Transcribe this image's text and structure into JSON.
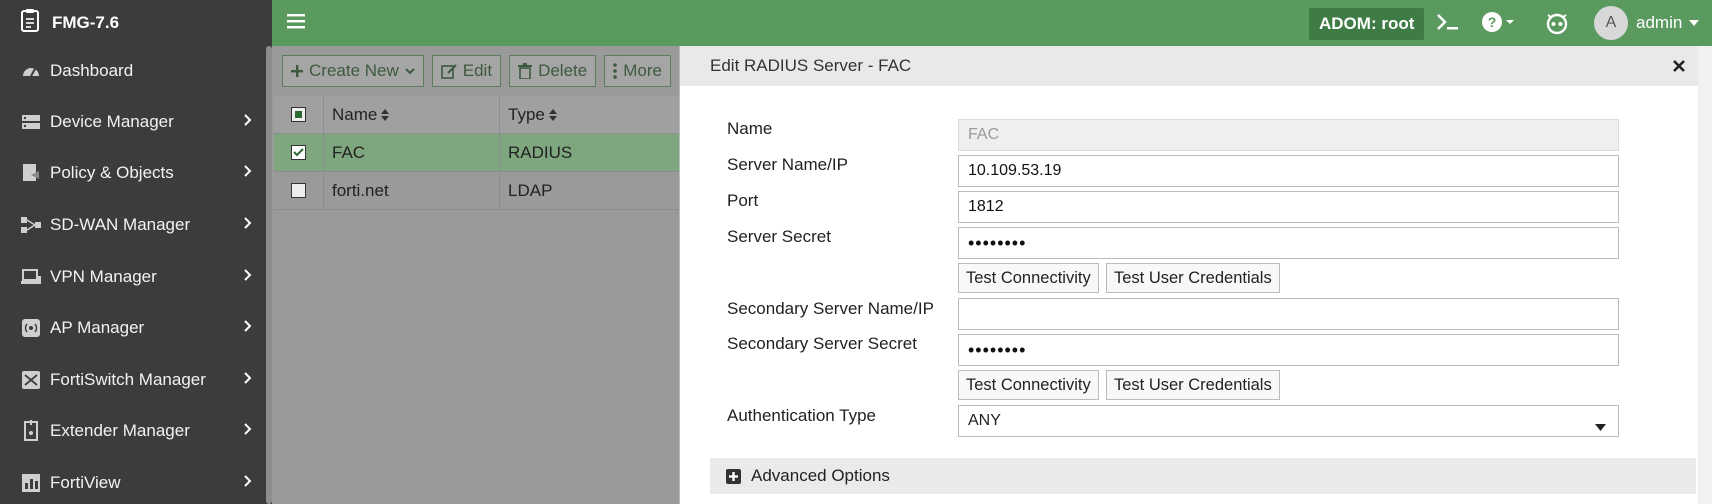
{
  "app": {
    "title": "FMG-7.6"
  },
  "sidebar": {
    "items": [
      {
        "label": "Dashboard",
        "icon": "dashboard-icon",
        "has_submenu": false
      },
      {
        "label": "Device Manager",
        "icon": "device-manager-icon",
        "has_submenu": true
      },
      {
        "label": "Policy & Objects",
        "icon": "policy-objects-icon",
        "has_submenu": true
      },
      {
        "label": "SD-WAN Manager",
        "icon": "sdwan-icon",
        "has_submenu": true
      },
      {
        "label": "VPN Manager",
        "icon": "vpn-icon",
        "has_submenu": true
      },
      {
        "label": "AP Manager",
        "icon": "ap-icon",
        "has_submenu": true
      },
      {
        "label": "FortiSwitch Manager",
        "icon": "fortiswitch-icon",
        "has_submenu": true
      },
      {
        "label": "Extender Manager",
        "icon": "extender-icon",
        "has_submenu": true
      },
      {
        "label": "FortiView",
        "icon": "fortiview-icon",
        "has_submenu": true
      }
    ]
  },
  "topbar": {
    "adom_label": "ADOM: root",
    "user_initial": "A",
    "user_name": "admin"
  },
  "toolbar": {
    "create_new": "Create New",
    "edit": "Edit",
    "delete": "Delete",
    "more": "More"
  },
  "table": {
    "columns": [
      "Name",
      "Type"
    ],
    "rows": [
      {
        "name": "FAC",
        "type": "RADIUS",
        "selected": true
      },
      {
        "name": "forti.net",
        "type": "LDAP",
        "selected": false
      }
    ]
  },
  "modal": {
    "title": "Edit RADIUS Server - FAC",
    "labels": {
      "name": "Name",
      "server": "Server Name/IP",
      "port": "Port",
      "secret": "Server Secret",
      "secondary_server": "Secondary Server Name/IP",
      "secondary_secret": "Secondary Server Secret",
      "auth_type": "Authentication Type"
    },
    "values": {
      "name": "FAC",
      "server": "10.109.53.19",
      "port": "1812",
      "secret": "••••••••",
      "secondary_server": "",
      "secondary_secret": "••••••••",
      "auth_type": "ANY"
    },
    "buttons": {
      "test_connectivity": "Test Connectivity",
      "test_user_credentials": "Test User Credentials"
    },
    "advanced_options": "Advanced Options"
  },
  "colors": {
    "sidebar_bg": "#3c3c3c",
    "topbar_bg": "#5a9a5f",
    "adom_bg": "#3f7c45",
    "selected_row": "#7ea67f"
  }
}
